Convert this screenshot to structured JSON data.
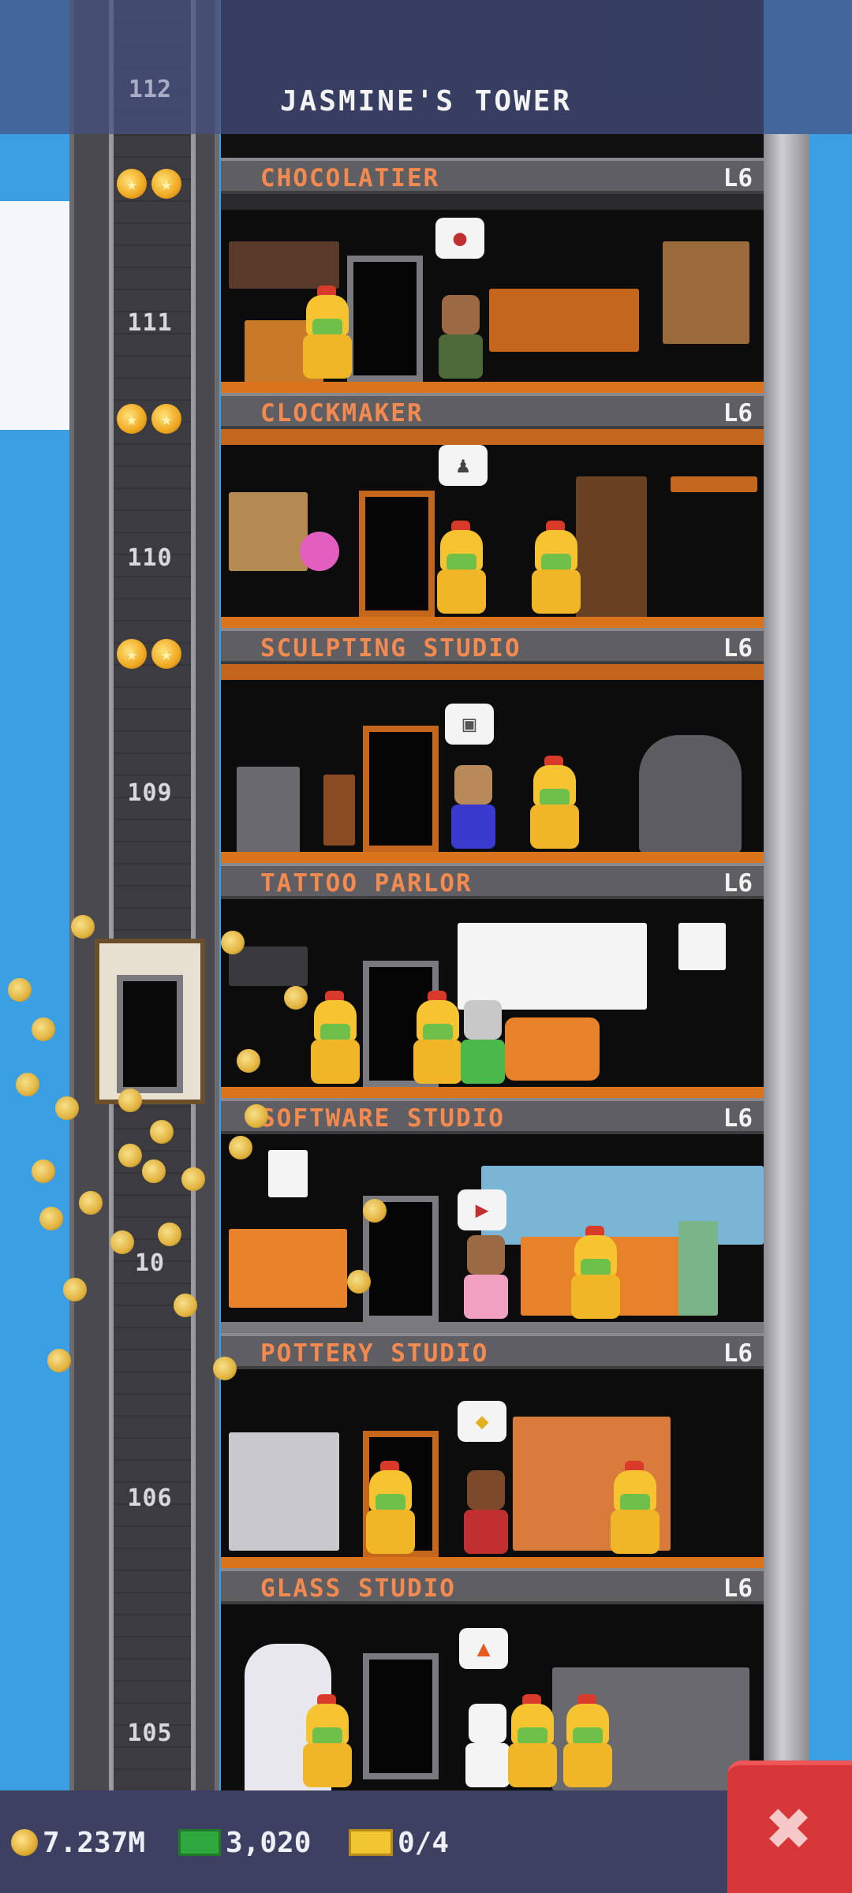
{
  "header": {
    "title": "JASMINE'S TOWER",
    "top_floor_number": "112"
  },
  "floors": [
    {
      "name": "CHOCOLATIER",
      "level": "L6",
      "number": "111",
      "stars": 2
    },
    {
      "name": "CLOCKMAKER",
      "level": "L6",
      "number": "110",
      "stars": 2
    },
    {
      "name": "SCULPTING STUDIO",
      "level": "L6",
      "number": "109",
      "stars": 2
    },
    {
      "name": "TATTOO PARLOR",
      "level": "L6",
      "number": "",
      "stars": 0
    },
    {
      "name": "SOFTWARE STUDIO",
      "level": "L6",
      "number": "10",
      "stars": 0
    },
    {
      "name": "POTTERY STUDIO",
      "level": "L6",
      "number": "106",
      "stars": 0
    },
    {
      "name": "GLASS STUDIO",
      "level": "L6",
      "number": "105",
      "stars": 0
    }
  ],
  "status": {
    "coins": "7.237M",
    "bux": "3,020",
    "tickets": "0/4"
  },
  "close_button": {
    "label": "✖"
  },
  "colors": {
    "banner_text": "#f58a50",
    "sky": "#3a9fe3",
    "close": "#d8373a"
  }
}
